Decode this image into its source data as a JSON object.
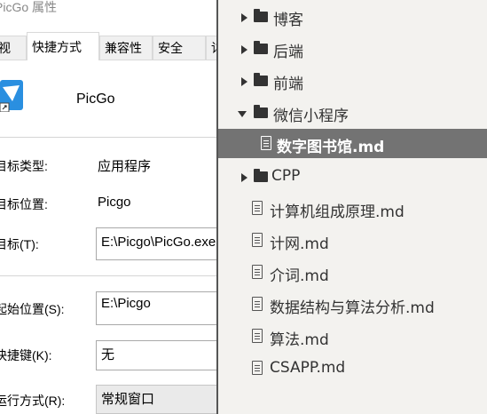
{
  "dialog": {
    "title": "PicGo 属性",
    "tabs": [
      "视",
      "快捷方式",
      "兼容性",
      "安全",
      "详"
    ],
    "app_name": "PicGo",
    "fields": {
      "target_type_label": "目标类型:",
      "target_type_value": "应用程序",
      "target_location_label": "目标位置:",
      "target_location_value": "Picgo",
      "target_label": "目标(T):",
      "target_value": "E:\\Picgo\\PicGo.exe",
      "start_in_label": "起始位置(S):",
      "start_in_value": "E:\\Picgo",
      "shortcut_key_label": "快捷键(K):",
      "shortcut_key_value": "无",
      "run_label": "运行方式(R):",
      "run_value": "常规窗口"
    }
  },
  "tree": {
    "items": [
      {
        "type": "folder",
        "state": "collapsed",
        "label": "博客",
        "icon": "folder-icon"
      },
      {
        "type": "folder",
        "state": "collapsed",
        "label": "后端",
        "icon": "folder-icon"
      },
      {
        "type": "folder",
        "state": "collapsed",
        "label": "前端",
        "icon": "folder-icon"
      },
      {
        "type": "folder",
        "state": "expanded",
        "label": "微信小程序",
        "icon": "folder-icon"
      },
      {
        "type": "file",
        "label": "数字图书馆.md",
        "selected": true,
        "icon": "file-icon"
      },
      {
        "type": "folder",
        "state": "collapsed",
        "label": "CPP",
        "icon": "folder-icon"
      },
      {
        "type": "file",
        "label": "计算机组成原理.md",
        "icon": "file-icon"
      },
      {
        "type": "file",
        "label": "计网.md",
        "icon": "file-icon"
      },
      {
        "type": "file",
        "label": "介词.md",
        "icon": "file-icon"
      },
      {
        "type": "file",
        "label": "数据结构与算法分析.md",
        "icon": "file-icon"
      },
      {
        "type": "file",
        "label": "算法.md",
        "icon": "file-icon"
      },
      {
        "type": "file",
        "label": "CSAPP.md",
        "icon": "file-icon"
      }
    ]
  },
  "colors": {
    "tree_background": "#f3f2ef",
    "selected_row": "#737373",
    "text": "#333333"
  }
}
